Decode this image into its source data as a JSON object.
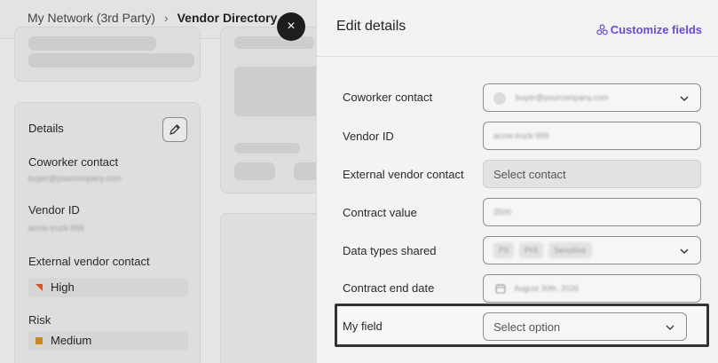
{
  "breadcrumb": {
    "parent": "My Network (3rd Party)",
    "separator": "›",
    "current": "Vendor Directory"
  },
  "close_icon": "×",
  "details_card": {
    "title": "Details",
    "fields": [
      {
        "label": "Coworker contact",
        "value": "buyer@yourcompany.com"
      },
      {
        "label": "Vendor ID",
        "value": "acme-truck-999"
      },
      {
        "label": "External vendor contact",
        "value": "High",
        "marker": "high"
      },
      {
        "label": "Risk",
        "value": "Medium",
        "marker": "medium"
      }
    ]
  },
  "drawer": {
    "title": "Edit details",
    "customize_label": "Customize fields",
    "rows": [
      {
        "label": "Coworker contact",
        "value": "buyer@yourcompany.com",
        "kind": "select"
      },
      {
        "label": "Vendor ID",
        "value": "acme-truck-999",
        "kind": "text"
      },
      {
        "label": "External vendor contact",
        "value": "Select contact",
        "kind": "disabled"
      },
      {
        "label": "Contract value",
        "value": "2500",
        "kind": "text"
      },
      {
        "label": "Data types shared",
        "tags": [
          "PII",
          "PHI",
          "Sensitive"
        ],
        "kind": "multiselect"
      },
      {
        "label": "Contract end date",
        "value": "August 30th, 2026",
        "kind": "date"
      },
      {
        "label": "My field",
        "value": "Select option",
        "kind": "select"
      }
    ]
  },
  "colors": {
    "accent": "#6a4bd8",
    "high": "#d9531e",
    "medium": "#c9861e"
  }
}
